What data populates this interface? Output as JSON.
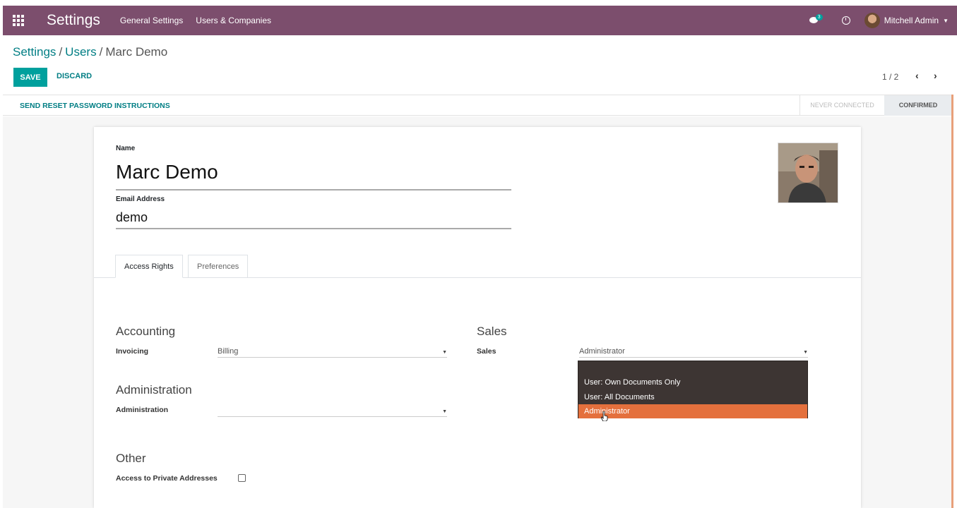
{
  "navbar": {
    "app_title": "Settings",
    "menus": [
      "General Settings",
      "Users & Companies"
    ],
    "chat_count": "3",
    "user_name": "Mitchell Admin",
    "brand_color": "#7c4e6d"
  },
  "breadcrumb": {
    "items": [
      "Settings",
      "Users",
      "Marc Demo"
    ]
  },
  "controls": {
    "save_label": "SAVE",
    "discard_label": "DISCARD",
    "pager": "1 / 2"
  },
  "statusbar": {
    "reset_label": "SEND RESET PASSWORD INSTRUCTIONS",
    "stages": [
      "NEVER CONNECTED",
      "CONFIRMED"
    ],
    "active_stage": "CONFIRMED"
  },
  "form": {
    "name_label": "Name",
    "name_value": "Marc Demo",
    "email_label": "Email Address",
    "email_value": "demo"
  },
  "tabs": [
    "Access Rights",
    "Preferences"
  ],
  "access": {
    "accounting": {
      "title": "Accounting",
      "field": "Invoicing",
      "value": "Billing"
    },
    "administration": {
      "title": "Administration",
      "field": "Administration",
      "value": ""
    },
    "other": {
      "title": "Other",
      "field": "Access to Private Addresses",
      "checked": false
    },
    "sales": {
      "title": "Sales",
      "field": "Sales",
      "value": "Administrator"
    }
  },
  "sales_dropdown": {
    "options": [
      "",
      "User: Own Documents Only",
      "User: All Documents",
      "Administrator"
    ],
    "highlighted": "Administrator",
    "highlight_color": "#e4703d"
  },
  "icons": [
    "apps-icon",
    "chat-icon",
    "clock-icon",
    "caret-down-icon",
    "chevron-left-icon",
    "chevron-right-icon",
    "pointer-cursor-icon"
  ]
}
